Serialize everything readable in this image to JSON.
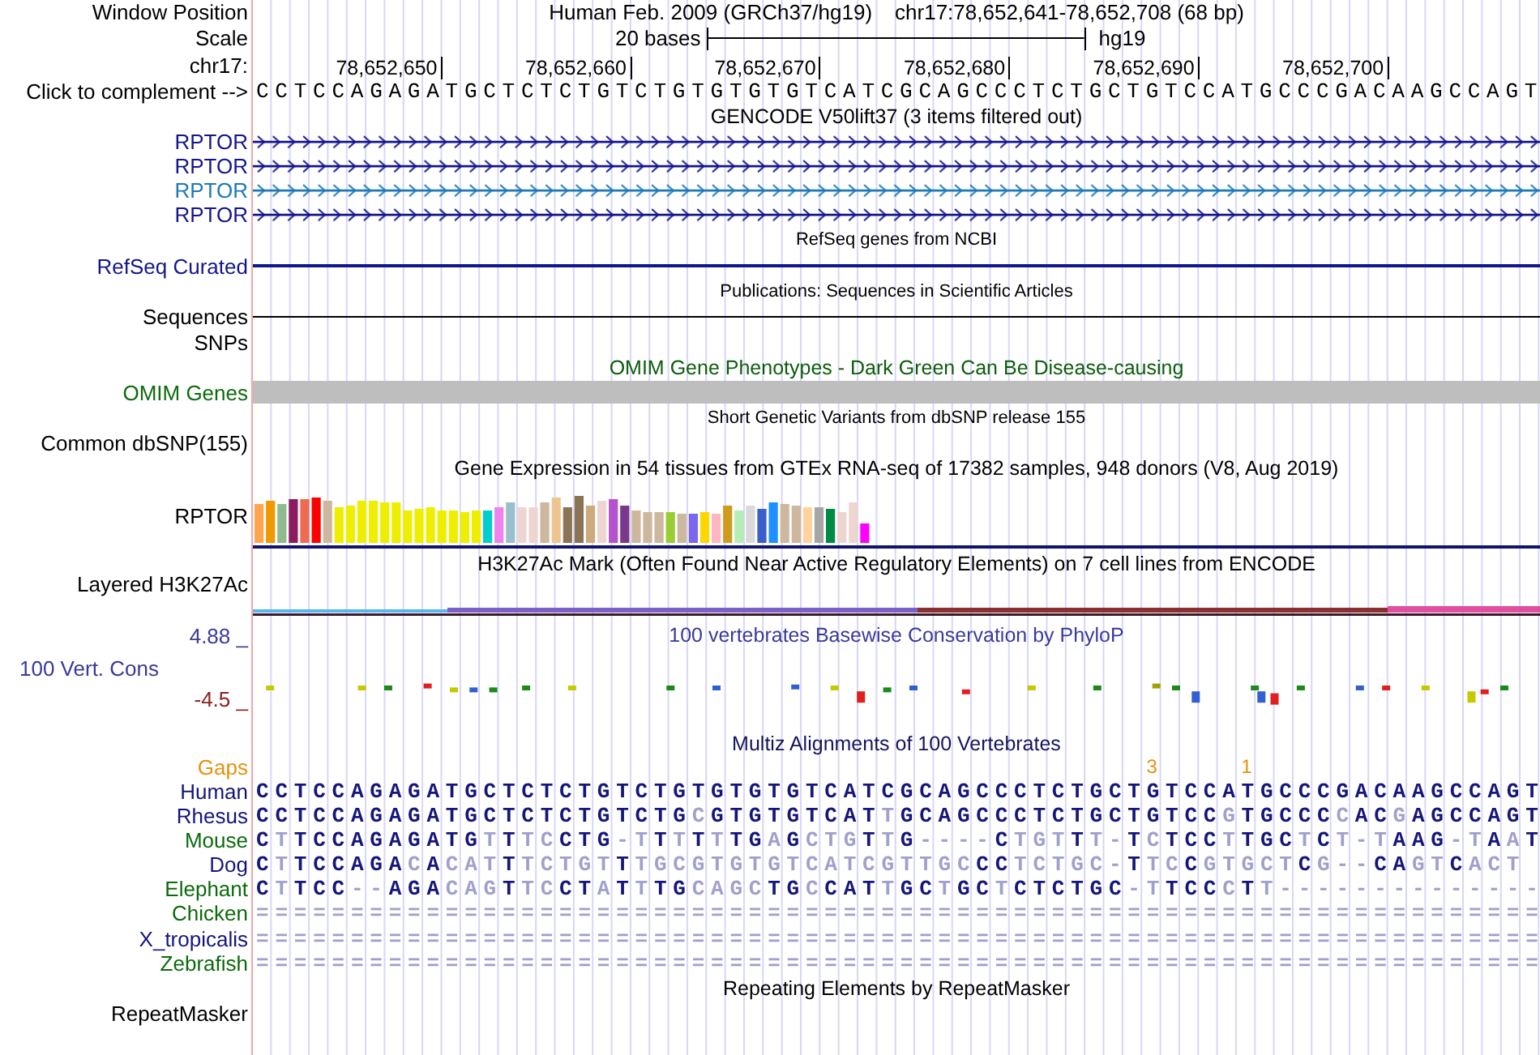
{
  "header": {
    "label": "Window Position",
    "assembly": "Human Feb. 2009 (GRCh37/hg19)",
    "position": "chr17:78,652,641-78,652,708 (68 bp)"
  },
  "scale": {
    "label": "Scale",
    "span": "20 bases",
    "assembly": "hg19"
  },
  "ruler": {
    "label": "chr17:",
    "ticks": [
      "78,652,650",
      "78,652,660",
      "78,652,670",
      "78,652,680",
      "78,652,690",
      "78,652,700"
    ]
  },
  "bases": {
    "label": "Click to complement -->",
    "sequence": "CCTCCAGAGATGCTCTCTGTCTGTGTGTGTCATCGCAGCCCTCTGCTGTCCATGCCCGACAAGCCAGT"
  },
  "tracks": [
    {
      "kind": "title",
      "text": "GENCODE V50lift37 (3 items filtered out)",
      "color": "#000000"
    },
    {
      "kind": "gene",
      "label": "RPTOR",
      "color": "#14148c"
    },
    {
      "kind": "gene",
      "label": "RPTOR",
      "color": "#14148c"
    },
    {
      "kind": "gene",
      "label": "RPTOR",
      "color": "#1c78b8"
    },
    {
      "kind": "gene",
      "label": "RPTOR",
      "color": "#14148c"
    },
    {
      "kind": "note",
      "text": "RefSeq genes from NCBI"
    },
    {
      "kind": "line",
      "label": "RefSeq Curated",
      "color": "#14148c"
    },
    {
      "kind": "note",
      "text": "Publications: Sequences in Scientific Articles"
    },
    {
      "kind": "line",
      "label": "Sequences",
      "color": "#000000"
    },
    {
      "kind": "label",
      "label": "SNPs"
    },
    {
      "kind": "title",
      "text": "OMIM Gene Phenotypes - Dark Green Can Be Disease-causing",
      "color": "#0c5c0c"
    },
    {
      "kind": "bar",
      "label": "OMIM Genes",
      "color": "#0c6b0c"
    },
    {
      "kind": "note",
      "text": "Short Genetic Variants from dbSNP release 155"
    },
    {
      "kind": "label",
      "label": "Common dbSNP(155)"
    },
    {
      "kind": "title",
      "text": "Gene Expression in 54 tissues from GTEx RNA-seq of 17382 samples, 948 donors (V8, Aug 2019)",
      "color": "#000000"
    },
    {
      "kind": "expression",
      "label": "RPTOR"
    },
    {
      "kind": "title",
      "text": "H3K27Ac Mark (Often Found Near Active Regulatory Elements) on 7 cell lines from ENCODE",
      "color": "#000000"
    },
    {
      "kind": "layered",
      "label": "Layered H3K27Ac"
    },
    {
      "kind": "conservation",
      "title": "100 vertebrates Basewise Conservation by PhyloP",
      "max": "4.88 _",
      "label": "100 Vert. Cons",
      "min": "-4.5 _"
    },
    {
      "kind": "title",
      "text": "Multiz Alignments of 100 Vertebrates",
      "color": "#14145c"
    },
    {
      "kind": "gaps",
      "label": "Gaps",
      "color": "#e8900c",
      "counts": "                                               3    1               "
    },
    {
      "kind": "species",
      "label": "Human",
      "color": "#14147c",
      "sequence": "CCTCCAGAGATGCTCTCTGTCTGTGTGTGTCATCGCAGCCCTCTGCTGTCCATGCCCGACAAGCCAGT"
    },
    {
      "kind": "species",
      "label": "Rhesus",
      "color": "#14147c",
      "sequence": "CCTCCAGAGATGCTCTCTGTCTGCGTGTGTCATTGCAGCCCTCTGCTGTCCGTGCCCCACGAGCCAGT"
    },
    {
      "kind": "species",
      "label": "Mouse",
      "color": "#0c6b0c",
      "sequence": "CTTCCAGAGATGTTTCCTG-TTTTTTGAGCTGTTG----CTGTTT-TCTCCTTGCTCT-TAAG-TAAT"
    },
    {
      "kind": "species",
      "label": "Dog",
      "color": "#14147c",
      "sequence": "CTTCCAGACACATTTCTGTTTGCGTGTGTCATCGTTGCCCTCTGC-TTCCGTGCTCG--CAGTCACT"
    },
    {
      "kind": "species",
      "label": "Elephant",
      "color": "#0c6b0c",
      "sequence": "CTTCC--AGACAGTTCCTATTTGCAGCTGCCATTGCTGCTCTCTGC-TTCCCTT--------------"
    },
    {
      "kind": "species",
      "label": "Chicken",
      "color": "#0c6b0c",
      "sequence": "===================================================================="
    },
    {
      "kind": "species",
      "label": "X_tropicalis",
      "color": "#14147c",
      "sequence": "===================================================================="
    },
    {
      "kind": "species",
      "label": "Zebrafish",
      "color": "#0c6b0c",
      "sequence": "===================================================================="
    },
    {
      "kind": "title",
      "text": "Repeating Elements by RepeatMasker",
      "color": "#000000"
    },
    {
      "kind": "label",
      "label": "RepeatMasker"
    }
  ]
}
